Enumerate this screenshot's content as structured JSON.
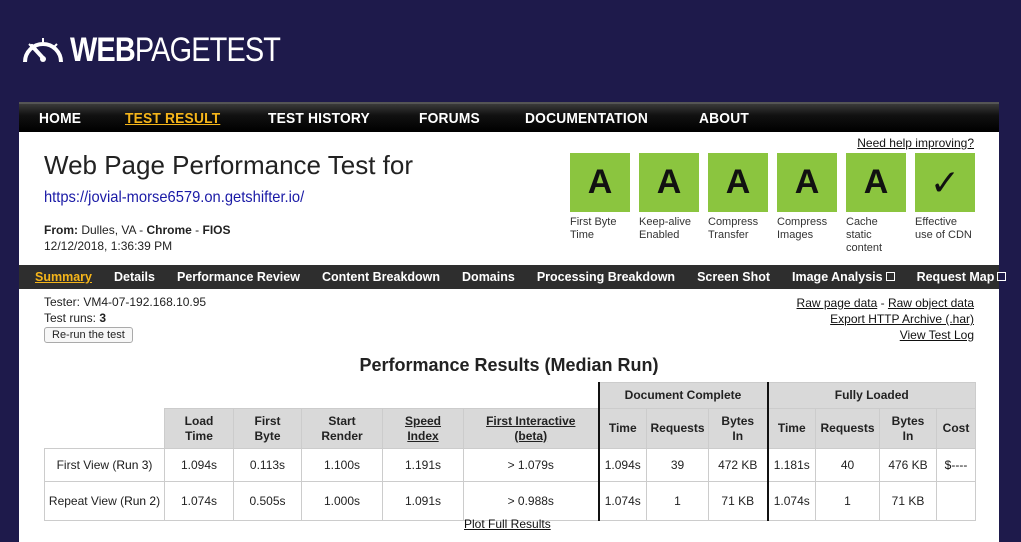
{
  "logo": {
    "bold": "WEB",
    "rest": "PAGETEST"
  },
  "nav": [
    {
      "label": "HOME"
    },
    {
      "label": "TEST RESULT",
      "active": true
    },
    {
      "label": "TEST HISTORY"
    },
    {
      "label": "FORUMS"
    },
    {
      "label": "DOCUMENTATION"
    },
    {
      "label": "ABOUT"
    }
  ],
  "header": {
    "title": "Web Page Performance Test for",
    "url": "https://jovial-morse6579.on.getshifter.io/",
    "from_label": "From:",
    "location": "Dulles, VA",
    "browser": "Chrome",
    "connection": "FIOS",
    "date": "12/12/2018, 1:36:39 PM",
    "help": "Need help improving?"
  },
  "grades": [
    {
      "value": "A",
      "label": "First Byte Time"
    },
    {
      "value": "A",
      "label": "Keep-alive Enabled"
    },
    {
      "value": "A",
      "label": "Compress Transfer"
    },
    {
      "value": "A",
      "label": "Compress Images"
    },
    {
      "value": "A",
      "label": "Cache static content"
    },
    {
      "value": "✓",
      "label": "Effective use of CDN"
    }
  ],
  "subnav": [
    {
      "label": "Summary",
      "active": true
    },
    {
      "label": "Details"
    },
    {
      "label": "Performance Review"
    },
    {
      "label": "Content Breakdown"
    },
    {
      "label": "Domains"
    },
    {
      "label": "Processing Breakdown"
    },
    {
      "label": "Screen Shot"
    },
    {
      "label": "Image Analysis",
      "external": true
    },
    {
      "label": "Request Map",
      "external": true
    }
  ],
  "info": {
    "tester": "Tester: VM4-07-192.168.10.95",
    "runs_label": "Test runs:",
    "runs": "3",
    "rerun": "Re-run the test"
  },
  "links": {
    "raw_page": "Raw page data",
    "sep": " - ",
    "raw_object": "Raw object data",
    "export": "Export HTTP Archive (.har)",
    "log": "View Test Log"
  },
  "results": {
    "title": "Performance Results (Median Run)",
    "group_doc": "Document Complete",
    "group_full": "Fully Loaded",
    "headers": {
      "load_time": [
        "Load",
        "Time"
      ],
      "first_byte": [
        "First",
        "Byte"
      ],
      "start_render": [
        "Start",
        "Render"
      ],
      "speed_index": [
        "Speed",
        "Index"
      ],
      "first_interactive": [
        "First Interactive",
        "(beta)"
      ],
      "time": "Time",
      "requests": "Requests",
      "bytes_in": [
        "Bytes",
        "In"
      ],
      "cost": "Cost"
    },
    "rows": [
      {
        "label": "First View (",
        "run": "Run 3",
        "close": ")",
        "load": "1.094s",
        "fb": "0.113s",
        "sr": "1.100s",
        "si": "1.191s",
        "fi": "> 1.079s",
        "dc_time": "1.094s",
        "dc_req": "39",
        "dc_bytes": "472 KB",
        "fl_time": "1.181s",
        "fl_req": "40",
        "fl_bytes": "476 KB",
        "cost": "$----"
      },
      {
        "label": "Repeat View (",
        "run": "Run 2",
        "close": ")",
        "load": "1.074s",
        "fb": "0.505s",
        "sr": "1.000s",
        "si": "1.091s",
        "fi": "> 0.988s",
        "dc_time": "1.074s",
        "dc_req": "1",
        "dc_bytes": "71 KB",
        "fl_time": "1.074s",
        "fl_req": "1",
        "fl_bytes": "71 KB",
        "cost": ""
      }
    ],
    "plot": "Plot Full Results"
  },
  "colors": {
    "background": "#1e1a4b",
    "grade_green": "#8bc53f",
    "active_link": "#f5b51a"
  }
}
